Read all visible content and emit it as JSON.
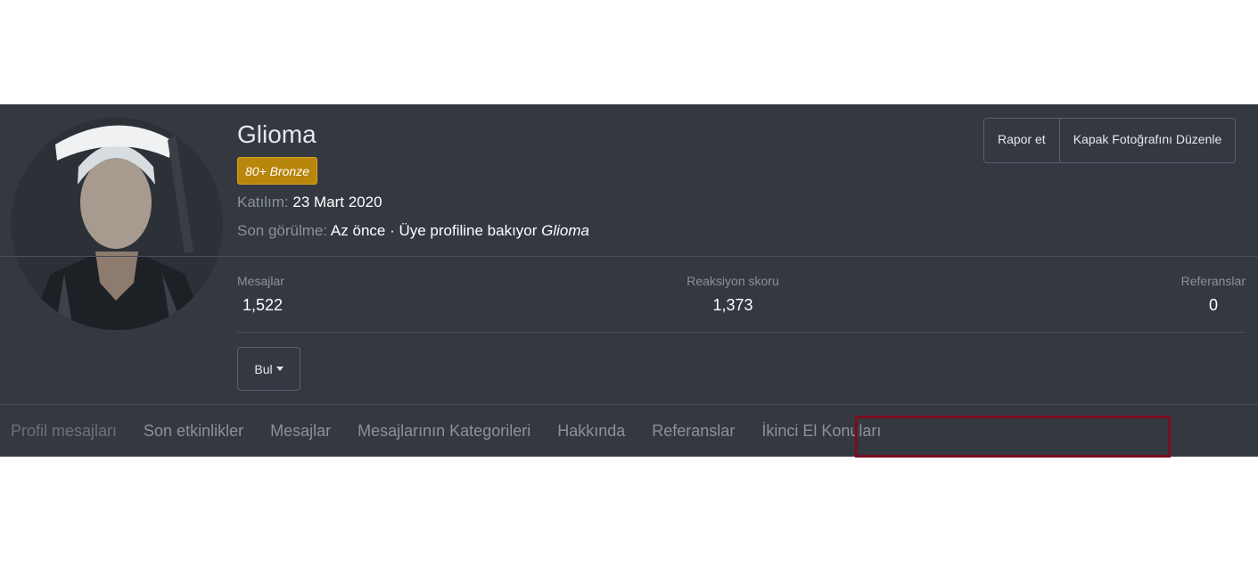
{
  "profile": {
    "username": "Glioma",
    "badge": "80+ Bronze",
    "joined_label": "Katılım:",
    "joined_value": "23 Mart 2020",
    "last_seen_label": "Son görülme:",
    "last_seen_value": "Az önce · Üye profiline bakıyor",
    "last_seen_user": "Glioma"
  },
  "actions": {
    "report": "Rapor et",
    "edit_cover": "Kapak Fotoğrafını Düzenle",
    "find": "Bul"
  },
  "stats": {
    "messages_label": "Mesajlar",
    "messages_value": "1,522",
    "reactions_label": "Reaksiyon skoru",
    "reactions_value": "1,373",
    "refs_label": "Referanslar",
    "refs_value": "0"
  },
  "tabs": [
    "Profil mesajları",
    "Son etkinlikler",
    "Mesajlar",
    "Mesajlarının Kategorileri",
    "Hakkında",
    "Referanslar",
    "İkinci El Konuları"
  ],
  "colors": {
    "background": "#343841",
    "badge": "#b8860b",
    "highlight": "#7a0e1e"
  }
}
